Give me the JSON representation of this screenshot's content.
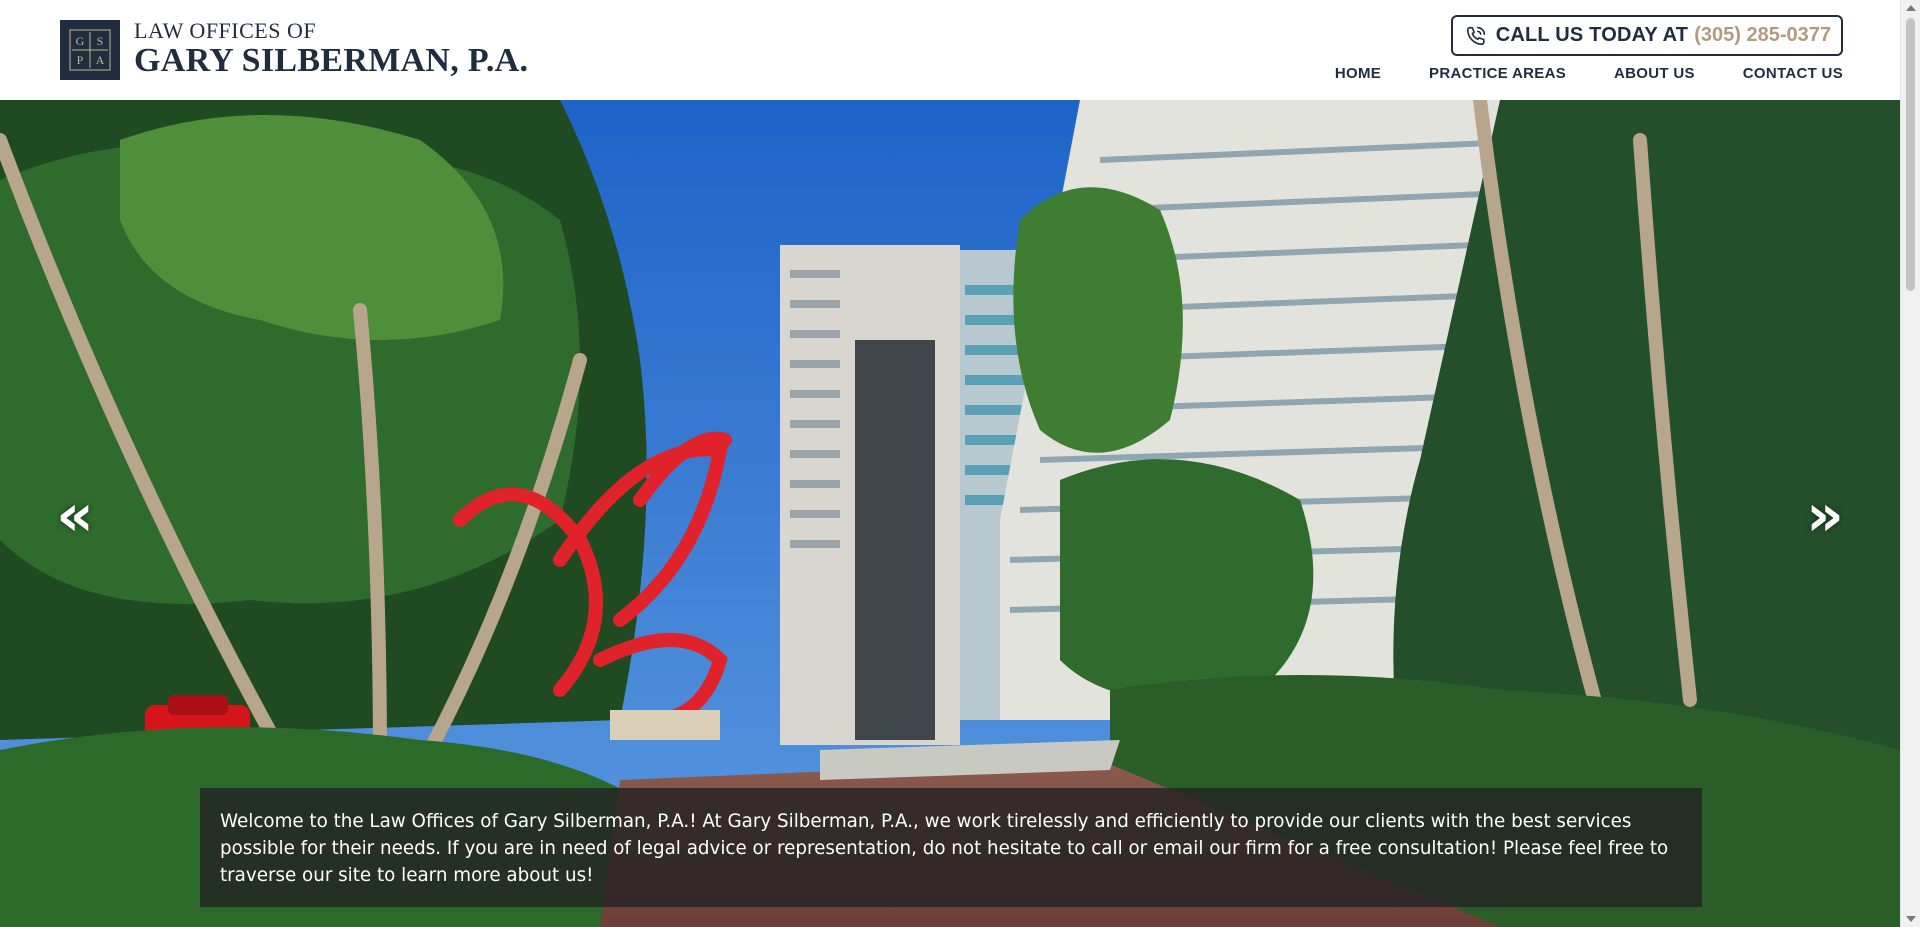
{
  "header": {
    "logo": {
      "monogram": [
        "G",
        "S",
        "P",
        "A"
      ],
      "line1": "LAW OFFICES OF",
      "line2": "GARY SILBERMAN, P.A."
    },
    "call": {
      "label": "CALL US TODAY AT",
      "number": "(305) 285-0377",
      "icon": "phone-icon"
    },
    "nav": [
      "HOME",
      "PRACTICE AREAS",
      "ABOUT US",
      "CONTACT US"
    ]
  },
  "hero": {
    "prev_label": "«",
    "next_label": "»",
    "caption": "Welcome to the Law Offices of Gary Silberman, P.A.! At Gary Silberman, P.A., we work tirelessly and efficiently to provide our clients with the best services possible for their needs. If you are in need of legal advice or representation, do not hesitate to call or email our firm for a free consultation! Please feel free to traverse our site to learn more about us!"
  },
  "colors": {
    "brand_navy": "#1f2d3f",
    "phone_accent": "#b39a7e",
    "sky": "#2f78d6",
    "sculpture_red": "#e0232a"
  }
}
